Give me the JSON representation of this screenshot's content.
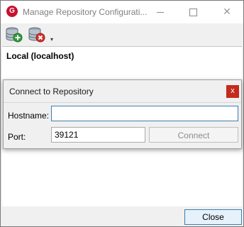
{
  "window": {
    "title": "Manage Repository Configurati...",
    "app_icon_letter": "G",
    "close_glyph": "✕"
  },
  "toolbar": {
    "add_icon": "database-add-icon",
    "remove_icon": "database-remove-icon",
    "more_glyph": "▾"
  },
  "repositories": [
    {
      "label": "Local  (localhost)"
    }
  ],
  "dialog": {
    "title": "Connect to Repository",
    "close_glyph": "x",
    "hostname_label": "Hostname:",
    "hostname_value": "",
    "port_label": "Port:",
    "port_value": "39121",
    "connect_label": "Connect"
  },
  "footer": {
    "close_label": "Close"
  },
  "colors": {
    "accent": "#3c7fb1",
    "close_red": "#c42b1c",
    "app_icon_red": "#c8102e"
  }
}
